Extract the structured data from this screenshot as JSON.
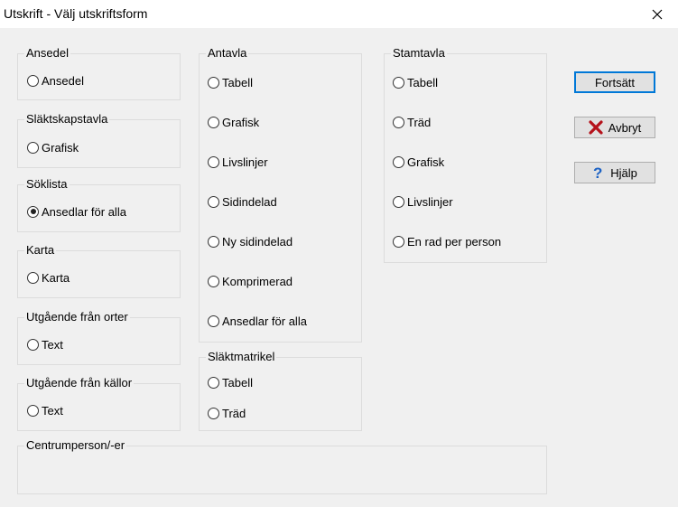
{
  "window": {
    "title": "Utskrift - Välj utskriftsform"
  },
  "groups": {
    "ansedel": {
      "legend": "Ansedel",
      "options": [
        "Ansedel"
      ]
    },
    "slaktskapstavla": {
      "legend": "Släktskapstavla",
      "options": [
        "Grafisk"
      ]
    },
    "soklista": {
      "legend": "Söklista",
      "options": [
        "Ansedlar för alla"
      ]
    },
    "karta": {
      "legend": "Karta",
      "options": [
        "Karta"
      ]
    },
    "orter": {
      "legend": "Utgående från orter",
      "options": [
        "Text"
      ]
    },
    "kallor": {
      "legend": "Utgående från källor",
      "options": [
        "Text"
      ]
    },
    "antavla": {
      "legend": "Antavla",
      "options": [
        "Tabell",
        "Grafisk",
        "Livslinjer",
        "Sidindelad",
        "Ny sidindelad",
        "Komprimerad",
        "Ansedlar för alla"
      ]
    },
    "slaktmatrikel": {
      "legend": "Släktmatrikel",
      "options": [
        "Tabell",
        "Träd"
      ]
    },
    "stamtavla": {
      "legend": "Stamtavla",
      "options": [
        "Tabell",
        "Träd",
        "Grafisk",
        "Livslinjer",
        "En rad per person"
      ]
    },
    "centrumperson": {
      "legend": "Centrumperson/-er"
    }
  },
  "selected": "soklista.0",
  "buttons": {
    "continue": "Fortsätt",
    "cancel": "Avbryt",
    "help": "Hjälp"
  },
  "icons": {
    "cancel": "red-x-icon",
    "help": "question-icon",
    "close": "close-icon"
  }
}
